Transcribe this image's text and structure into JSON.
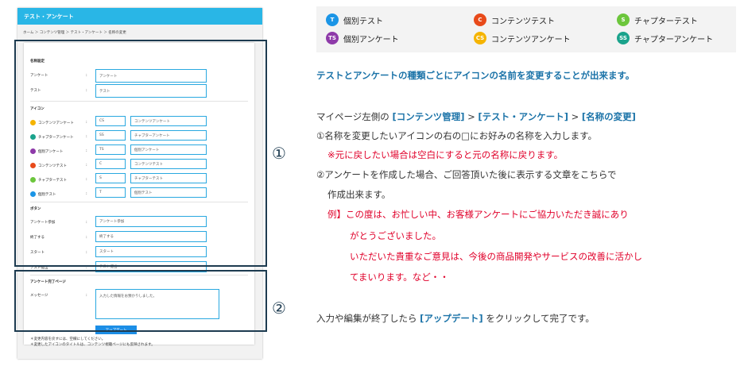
{
  "screenshot": {
    "header_title": "テスト・アンケート",
    "breadcrumb": "ホーム ＞ コンテンツ管理 ＞ テスト・アンケート ＞ 名称の変更",
    "sec_name": "名称設定",
    "name_rows": [
      {
        "label": "アンケート",
        "value": "アンケート"
      },
      {
        "label": "テスト",
        "value": "テスト"
      }
    ],
    "sec_icon": "アイコン",
    "icon_rows": [
      {
        "label": "コンテンツアンケート",
        "color": "#f5b400",
        "short": "CS",
        "long": "コンテンツアンケート"
      },
      {
        "label": "チャプターアンケート",
        "color": "#1aa38c",
        "short": "SS",
        "long": "チャプターアンケート"
      },
      {
        "label": "個別アンケート",
        "color": "#8e3aa9",
        "short": "TS",
        "long": "個別アンケート"
      },
      {
        "label": "コンテンツテスト",
        "color": "#e84a1a",
        "short": "C",
        "long": "コンテンツテスト"
      },
      {
        "label": "チャプターテスト",
        "color": "#6cc63c",
        "short": "S",
        "long": "チャプターテスト"
      },
      {
        "label": "個別テスト",
        "color": "#1b95e6",
        "short": "T",
        "long": "個別テスト"
      }
    ],
    "sec_button": "ボタン",
    "button_rows": [
      {
        "label": "アンケート参加",
        "value": "アンケート参加"
      },
      {
        "label": "終了する",
        "value": "終了する"
      },
      {
        "label": "スタート",
        "value": "スタート"
      },
      {
        "label": "テスト提出",
        "value": "テスト提出"
      }
    ],
    "sec_complete": "アンケート完了ページ",
    "message_label": "メッセージ",
    "message_value": "入力した情報をお預かりしました。",
    "update_button": "アップデート",
    "note1": "＊変更内容を戻すには、空欄にしてください。",
    "note2": "＊変更したアイコンのタイトルは、コンテンツ視聴ページにも反映されます。"
  },
  "markers": {
    "one": "①",
    "two": "②"
  },
  "legend": [
    {
      "icon": "T",
      "color": "#1b95e6",
      "label": "個別テスト"
    },
    {
      "icon": "C",
      "color": "#e84a1a",
      "label": "コンテンツテスト"
    },
    {
      "icon": "S",
      "color": "#6cc63c",
      "label": "チャプターテスト"
    },
    {
      "icon": "TS",
      "color": "#8e3aa9",
      "label": "個別アンケート"
    },
    {
      "icon": "CS",
      "color": "#f5b400",
      "label": "コンテンツアンケート"
    },
    {
      "icon": "SS",
      "color": "#1aa38c",
      "label": "チャプターアンケート"
    }
  ],
  "text": {
    "heading": "テストとアンケートの種類ごとにアイコンの名前を変更することが出来ます。",
    "path_pre": "マイページ左側の",
    "path_1": "[コンテンツ管理]",
    "path_sep1": " > ",
    "path_2": "[テスト・アンケート]",
    "path_sep2": " > ",
    "path_3": "[名称の変更]",
    "step1": "①名称を変更したいアイコンの右の□にお好みの名称を入力します。",
    "step1_note": "※元に戻したい場合は空白にすると元の名称に戻ります。",
    "step2_a": "②アンケートを作成した場合、ご回答頂いた後に表示する文章をこちらで",
    "step2_b": "作成出来ます。",
    "ex_a": "例】この度は、お忙しい中、お客様アンケートにご協力いただき誠にあり",
    "ex_b": "がとうございました。",
    "ex_c": "いただいた貴重なご意見は、今後の商品開発やサービスの改善に活かし",
    "ex_d": "てまいります。など・・",
    "final_pre": "入力や編集が終了したら",
    "final_btn": "[アップデート]",
    "final_post": "をクリックして完了です。"
  },
  "colors": {
    "accent": "#29b6e6",
    "frame": "#1d3b50",
    "heading": "#1b73a8",
    "warning": "#e0002a"
  }
}
